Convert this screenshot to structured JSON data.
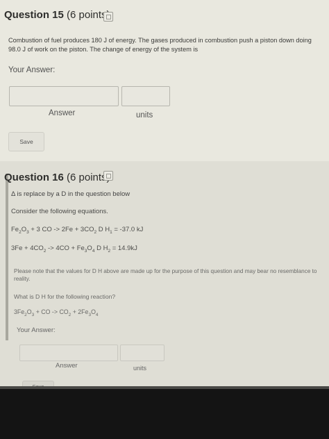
{
  "q15": {
    "title": "Question 15",
    "points": " (6 points)",
    "text": "Combustion of fuel produces 180 J of energy. The gases produced in combustion push a piston down doing 98.0 J of work on the piston. The change of energy of the system is",
    "your_answer": "Your Answer:",
    "answer_label": "Answer",
    "units_label": "units",
    "save_label": "Save"
  },
  "q16": {
    "title": "Question 16",
    "points": " (6 points)",
    "notice_glyph": "Δ",
    "notice": " is replace by a D in the question below",
    "consider": "Consider the following equations.",
    "eq1": {
      "a": "Fe",
      "a1": "2",
      "b": "O",
      "b1": "3",
      "c": " + 3 CO -> 2Fe + 3CO",
      "c1": "2",
      "d": " D H",
      "d1": "1",
      "e": " = -37.0 kJ"
    },
    "eq2": {
      "a": "3Fe + 4CO",
      "a1": "2",
      "b": " -> 4CO + Fe",
      "b1": "3",
      "c": "O",
      "c1": "4",
      "d": " D H",
      "d1": "2",
      "e": " = 14.9kJ"
    },
    "note": "Please note that the values for D H above are made up for the purpose of this question and may bear no resemblance to reality.",
    "what": "What is D H for the following reaction?",
    "eq3": {
      "a": "3Fe",
      "a1": "2",
      "b": "O",
      "b1": "3",
      "c": " + CO -> CO",
      "c1": "2",
      "d": " + 2Fe",
      "d1": "3",
      "e": "O",
      "e1": "4"
    },
    "your_answer": "Your Answer:",
    "answer_label": "Answer",
    "units_label": "units",
    "save_label": "Save"
  }
}
